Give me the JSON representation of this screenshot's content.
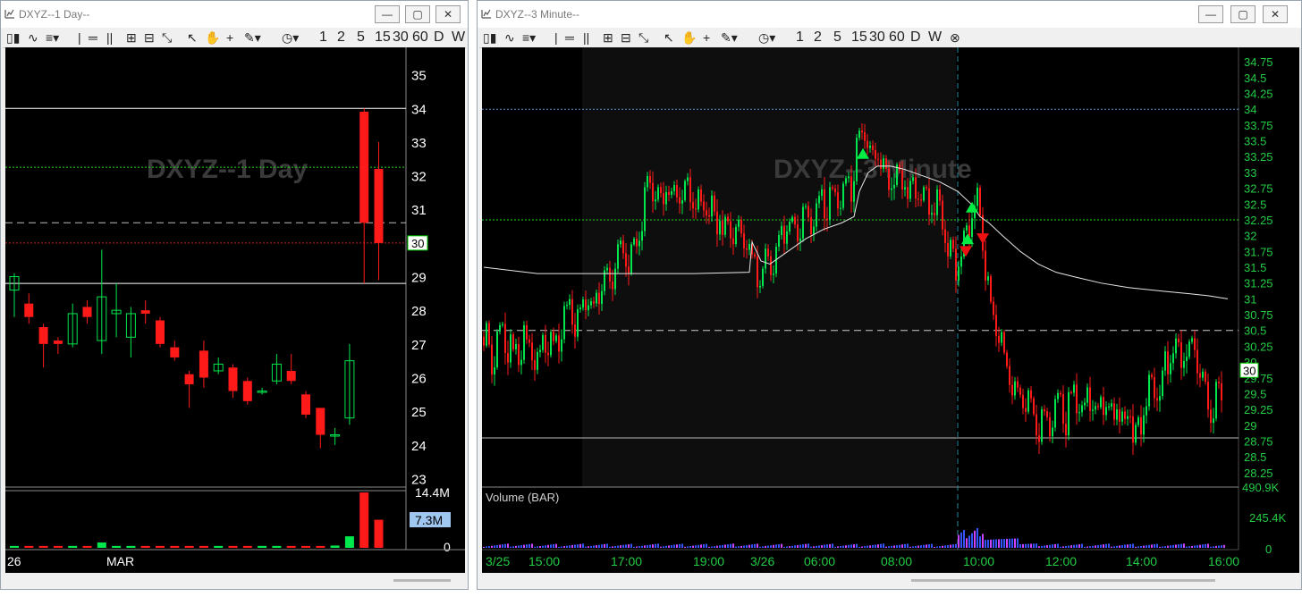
{
  "left_window": {
    "title": "DXYZ--1 Day--",
    "watermark": "DXYZ--1 Day",
    "toolbar_intervals": [
      "1",
      "2",
      "5",
      "15",
      "30",
      "60",
      "D",
      "W"
    ],
    "price_axis": [
      "35",
      "34",
      "33",
      "32",
      "31",
      "30",
      "29",
      "28",
      "27",
      "26",
      "25",
      "24",
      "23"
    ],
    "price_badge": "30",
    "volume_axis": [
      "14.4M",
      "0"
    ],
    "volume_badge": "7.3M",
    "time_labels": [
      "26",
      "MAR"
    ]
  },
  "right_window": {
    "title": "DXYZ--3 Minute--",
    "watermark": "DXYZ--3 Minute",
    "toolbar_intervals": [
      "1",
      "2",
      "5",
      "15",
      "30",
      "60",
      "D",
      "W"
    ],
    "price_axis": [
      "34.75",
      "34.5",
      "34.25",
      "34",
      "33.75",
      "33.5",
      "33.25",
      "33",
      "32.75",
      "32.5",
      "32.25",
      "32",
      "31.75",
      "31.5",
      "31.25",
      "31",
      "30.75",
      "30.5",
      "30.25",
      "30",
      "29.75",
      "29.5",
      "29.25",
      "29",
      "28.75",
      "28.5",
      "28.25"
    ],
    "price_badge": "30",
    "volume_label": "Volume (BAR)",
    "volume_axis": [
      "490.9K",
      "245.4K",
      "0"
    ],
    "time_labels": [
      "3/25",
      "15:00",
      "17:00",
      "19:00",
      "3/26",
      "06:00",
      "08:00",
      "10:00",
      "12:00",
      "14:00",
      "16:00"
    ]
  },
  "colors": {
    "up": "#00e64d",
    "down": "#ff1a1a",
    "background": "#000000",
    "axis_text": "#22cc44"
  },
  "chart_data": [
    {
      "type": "candlestick",
      "title": "DXYZ--1 Day",
      "ylim": [
        22.8,
        35.6
      ],
      "candles": [
        {
          "o": 28.6,
          "h": 29.1,
          "l": 27.8,
          "c": 29.0
        },
        {
          "o": 28.2,
          "h": 28.5,
          "l": 27.6,
          "c": 27.8
        },
        {
          "o": 27.5,
          "h": 27.6,
          "l": 26.3,
          "c": 27.0
        },
        {
          "o": 27.1,
          "h": 27.2,
          "l": 26.7,
          "c": 27.0
        },
        {
          "o": 27.0,
          "h": 28.2,
          "l": 26.9,
          "c": 27.9
        },
        {
          "o": 28.1,
          "h": 28.3,
          "l": 27.6,
          "c": 27.8
        },
        {
          "o": 27.1,
          "h": 29.8,
          "l": 26.7,
          "c": 28.4
        },
        {
          "o": 27.9,
          "h": 28.8,
          "l": 27.2,
          "c": 28.0
        },
        {
          "o": 27.2,
          "h": 28.1,
          "l": 26.6,
          "c": 27.9
        },
        {
          "o": 28.0,
          "h": 28.3,
          "l": 27.6,
          "c": 27.9
        },
        {
          "o": 27.7,
          "h": 27.8,
          "l": 26.9,
          "c": 27.0
        },
        {
          "o": 26.9,
          "h": 27.1,
          "l": 26.5,
          "c": 26.6
        },
        {
          "o": 26.1,
          "h": 26.2,
          "l": 25.1,
          "c": 25.8
        },
        {
          "o": 26.8,
          "h": 27.1,
          "l": 25.7,
          "c": 26.0
        },
        {
          "o": 26.2,
          "h": 26.6,
          "l": 26.1,
          "c": 26.4
        },
        {
          "o": 26.3,
          "h": 26.4,
          "l": 25.4,
          "c": 25.6
        },
        {
          "o": 25.9,
          "h": 26.0,
          "l": 25.2,
          "c": 25.3
        },
        {
          "o": 25.6,
          "h": 25.7,
          "l": 25.5,
          "c": 25.6
        },
        {
          "o": 25.9,
          "h": 26.7,
          "l": 25.8,
          "c": 26.4
        },
        {
          "o": 26.2,
          "h": 26.7,
          "l": 25.8,
          "c": 25.9
        },
        {
          "o": 25.5,
          "h": 25.6,
          "l": 24.8,
          "c": 24.9
        },
        {
          "o": 25.1,
          "h": 25.1,
          "l": 23.9,
          "c": 24.3
        },
        {
          "o": 24.3,
          "h": 24.5,
          "l": 24.0,
          "c": 24.3
        },
        {
          "o": 24.8,
          "h": 27.0,
          "l": 24.6,
          "c": 26.5
        },
        {
          "o": 33.9,
          "h": 34.0,
          "l": 28.8,
          "c": 30.6
        },
        {
          "o": 32.2,
          "h": 33.0,
          "l": 28.9,
          "c": 30.0
        }
      ],
      "volume": [
        0.5,
        0.5,
        0.5,
        0.5,
        0.5,
        0.5,
        1.4,
        0.5,
        0.5,
        0.5,
        0.5,
        0.5,
        0.5,
        0.5,
        0.5,
        0.5,
        0.5,
        0.5,
        0.5,
        0.5,
        0.5,
        0.5,
        0.6,
        3.0,
        14.4,
        7.3
      ],
      "volume_max": 14.4,
      "levels": [
        {
          "price": 34.0,
          "style": "solid",
          "color": "#ffffff"
        },
        {
          "price": 32.25,
          "style": "dotted",
          "color": "#22dd22"
        },
        {
          "price": 30.6,
          "style": "dashed",
          "color": "#bbbbbb"
        },
        {
          "price": 30.0,
          "style": "dotted",
          "color": "#cc2222"
        },
        {
          "price": 28.8,
          "style": "solid",
          "color": "#ffffff"
        }
      ]
    },
    {
      "type": "candlestick",
      "title": "DXYZ--3 Minute",
      "ylim": [
        28.05,
        34.95
      ],
      "price_path": [
        [
          0,
          30.4
        ],
        [
          3,
          30.6
        ],
        [
          8,
          30.0
        ],
        [
          15,
          30.5
        ],
        [
          22,
          30.6
        ],
        [
          30,
          30.3
        ],
        [
          38,
          30.1
        ],
        [
          45,
          30.5
        ],
        [
          52,
          30.4
        ],
        [
          58,
          30.2
        ],
        [
          62,
          30.3
        ],
        [
          70,
          30.5
        ],
        [
          80,
          30.4
        ],
        [
          90,
          30.8
        ],
        [
          98,
          30.9
        ],
        [
          106,
          30.7
        ],
        [
          114,
          31.1
        ],
        [
          122,
          31.0
        ],
        [
          130,
          31.3
        ],
        [
          138,
          31.4
        ],
        [
          146,
          31.6
        ],
        [
          154,
          31.9
        ],
        [
          162,
          31.8
        ],
        [
          170,
          32.0
        ],
        [
          176,
          32.3
        ],
        [
          182,
          32.8
        ],
        [
          186,
          33.0
        ],
        [
          190,
          32.9
        ],
        [
          196,
          32.7
        ],
        [
          202,
          32.9
        ],
        [
          208,
          32.8
        ],
        [
          214,
          32.7
        ],
        [
          218,
          32.8
        ],
        [
          222,
          32.9
        ],
        [
          297,
          32.0
        ],
        [
          300,
          31.8
        ],
        [
          305,
          31.6
        ],
        [
          310,
          31.3
        ],
        [
          314,
          31.7
        ],
        [
          320,
          31.5
        ],
        [
          328,
          31.8
        ],
        [
          336,
          32.2
        ],
        [
          344,
          32.3
        ],
        [
          352,
          32.2
        ],
        [
          360,
          32.5
        ],
        [
          366,
          32.3
        ],
        [
          372,
          32.4
        ],
        [
          380,
          32.7
        ],
        [
          386,
          32.6
        ],
        [
          392,
          32.8
        ],
        [
          398,
          32.6
        ],
        [
          404,
          32.9
        ],
        [
          410,
          32.8
        ],
        [
          416,
          33.4
        ],
        [
          420,
          33.7
        ],
        [
          424,
          33.9
        ],
        [
          428,
          33.6
        ],
        [
          434,
          33.5
        ],
        [
          440,
          33.4
        ],
        [
          446,
          33.2
        ],
        [
          452,
          32.9
        ],
        [
          458,
          33.2
        ],
        [
          464,
          33.1
        ],
        [
          470,
          33.0
        ],
        [
          476,
          32.8
        ],
        [
          482,
          32.9
        ],
        [
          488,
          32.7
        ],
        [
          494,
          32.8
        ],
        [
          500,
          32.6
        ],
        [
          506,
          32.7
        ],
        [
          512,
          32.3
        ],
        [
          518,
          32.1
        ],
        [
          524,
          31.9
        ],
        [
          530,
          31.6
        ],
        [
          534,
          31.9
        ],
        [
          540,
          32.2
        ],
        [
          546,
          32.6
        ],
        [
          550,
          32.9
        ],
        [
          554,
          32.4
        ],
        [
          558,
          32.0
        ],
        [
          562,
          31.5
        ],
        [
          566,
          31.0
        ],
        [
          572,
          30.8
        ],
        [
          578,
          30.5
        ],
        [
          584,
          30.0
        ],
        [
          590,
          29.8
        ],
        [
          596,
          29.5
        ],
        [
          602,
          29.4
        ],
        [
          608,
          29.6
        ],
        [
          614,
          29.2
        ],
        [
          620,
          29.1
        ],
        [
          626,
          29.4
        ],
        [
          632,
          28.9
        ],
        [
          638,
          29.3
        ],
        [
          644,
          29.5
        ],
        [
          650,
          29.2
        ],
        [
          656,
          29.5
        ],
        [
          662,
          29.6
        ],
        [
          668,
          29.4
        ],
        [
          674,
          29.5
        ],
        [
          680,
          29.6
        ],
        [
          686,
          29.3
        ],
        [
          692,
          29.5
        ],
        [
          698,
          29.4
        ],
        [
          704,
          29.2
        ],
        [
          710,
          29.5
        ],
        [
          716,
          29.2
        ],
        [
          722,
          29.4
        ],
        [
          728,
          29.0
        ],
        [
          734,
          29.2
        ],
        [
          740,
          29.5
        ],
        [
          746,
          29.8
        ],
        [
          752,
          29.7
        ],
        [
          758,
          29.9
        ],
        [
          764,
          30.1
        ],
        [
          770,
          30.3
        ],
        [
          774,
          30.5
        ],
        [
          778,
          30.4
        ],
        [
          782,
          30.2
        ],
        [
          786,
          30.5
        ],
        [
          790,
          30.3
        ],
        [
          794,
          30.5
        ],
        [
          798,
          30.2
        ],
        [
          802,
          30.0
        ],
        [
          806,
          29.8
        ],
        [
          810,
          29.5
        ],
        [
          814,
          29.3
        ],
        [
          818,
          29.6
        ],
        [
          822,
          29.8
        ],
        [
          826,
          29.8
        ]
      ],
      "vwap_path": [
        [
          0,
          31.5
        ],
        [
          60,
          31.4
        ],
        [
          110,
          31.4
        ],
        [
          180,
          31.4
        ],
        [
          235,
          31.4
        ],
        [
          297,
          31.42
        ],
        [
          300,
          31.9
        ],
        [
          310,
          31.6
        ],
        [
          320,
          31.55
        ],
        [
          340,
          31.75
        ],
        [
          360,
          31.95
        ],
        [
          380,
          32.1
        ],
        [
          400,
          32.2
        ],
        [
          414,
          32.3
        ],
        [
          420,
          32.7
        ],
        [
          430,
          33.0
        ],
        [
          440,
          33.1
        ],
        [
          455,
          33.1
        ],
        [
          470,
          33.05
        ],
        [
          490,
          32.95
        ],
        [
          510,
          32.85
        ],
        [
          530,
          32.7
        ],
        [
          545,
          32.5
        ],
        [
          555,
          32.3
        ],
        [
          565,
          32.2
        ],
        [
          580,
          32.0
        ],
        [
          600,
          31.75
        ],
        [
          620,
          31.55
        ],
        [
          640,
          31.42
        ],
        [
          660,
          31.35
        ],
        [
          690,
          31.25
        ],
        [
          720,
          31.18
        ],
        [
          760,
          31.12
        ],
        [
          790,
          31.08
        ],
        [
          810,
          31.05
        ],
        [
          832,
          31.0
        ]
      ],
      "markers": [
        {
          "x": 424,
          "price": 33.3,
          "dir": "up",
          "color": "#00ee44"
        },
        {
          "x": 546,
          "price": 32.45,
          "dir": "up",
          "color": "#00ee44"
        },
        {
          "x": 541,
          "price": 31.95,
          "dir": "up",
          "color": "#00ee44"
        },
        {
          "x": 539,
          "price": 31.75,
          "dir": "down",
          "color": "#ee1111"
        },
        {
          "x": 558,
          "price": 31.95,
          "dir": "down",
          "color": "#ee1111"
        }
      ],
      "volume_max": 490.9,
      "volume_spike_x": 530,
      "levels": [
        {
          "price": 34.0,
          "style": "dotted",
          "color": "#5a8cd6"
        },
        {
          "price": 32.25,
          "style": "dotted",
          "color": "#22dd22"
        },
        {
          "price": 30.5,
          "style": "dashed",
          "color": "#cccccc"
        },
        {
          "price": 28.8,
          "style": "solid",
          "color": "#bbbbbb"
        }
      ]
    }
  ]
}
